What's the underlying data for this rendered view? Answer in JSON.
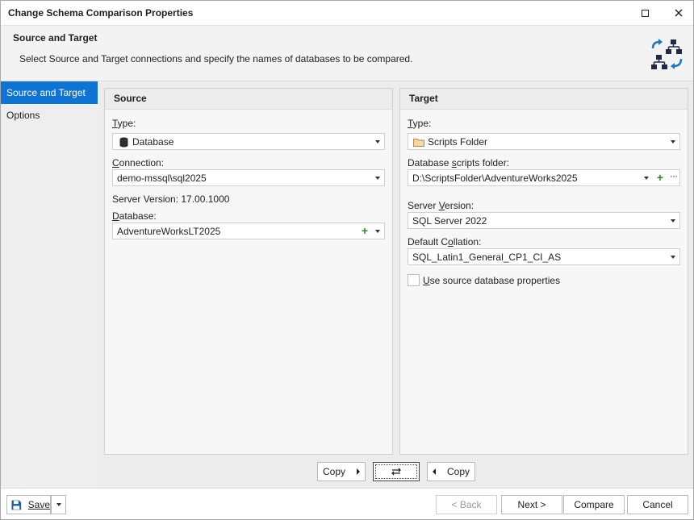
{
  "window": {
    "title": "Change Schema Comparison Properties",
    "maximize_icon": "maximize-icon",
    "close_icon": "close-icon"
  },
  "header": {
    "title": "Source and Target",
    "description": "Select Source and Target connections and specify the names of databases to be compared.",
    "icon": "schema-compare-icon"
  },
  "nav": {
    "items": [
      {
        "label": "Source and Target",
        "active": true
      },
      {
        "label": "Options",
        "active": false
      }
    ],
    "accent_color": "#0d73d5"
  },
  "source": {
    "heading": "Source",
    "type_label": "Type:",
    "type_value": "Database",
    "type_icon": "database-icon",
    "connection_label": "Connection:",
    "connection_value": "demo-mssql\\sql2025",
    "server_version_text": "Server Version: 17.00.1000",
    "database_label": "Database:",
    "database_value": "AdventureWorksLT2025"
  },
  "target": {
    "heading": "Target",
    "type_label": "Type:",
    "type_value": "Scripts Folder",
    "type_icon": "folder-icon",
    "scripts_folder_label": "Database scripts folder:",
    "scripts_folder_value": "D:\\ScriptsFolder\\AdventureWorks2025",
    "server_version_label": "Server Version:",
    "server_version_value": "SQL Server 2022",
    "collation_label": "Default Collation:",
    "collation_value": "SQL_Latin1_General_CP1_CI_AS",
    "use_source_label": "Use source database properties",
    "use_source_checked": false
  },
  "copy_bar": {
    "copy_right_label": "Copy",
    "swap_icon": "swap-icon",
    "copy_left_label": "Copy"
  },
  "footer": {
    "save_label": "Save",
    "save_icon": "save-icon",
    "back_label": "< Back",
    "next_label": "Next >",
    "compare_label": "Compare",
    "cancel_label": "Cancel"
  }
}
